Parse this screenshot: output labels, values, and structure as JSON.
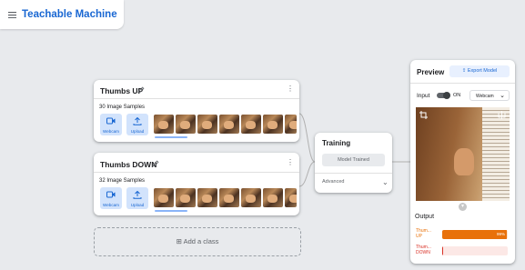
{
  "app": {
    "title": "Teachable Machine"
  },
  "classes": [
    {
      "name": "Thumbs UP",
      "samples": "30 Image Samples",
      "webcam_label": "Webcam",
      "upload_label": "Upload"
    },
    {
      "name": "Thumbs DOWN",
      "samples": "32 Image Samples",
      "webcam_label": "Webcam",
      "upload_label": "Upload"
    }
  ],
  "add_class_label": "Add a class",
  "training": {
    "title": "Training",
    "status_button": "Model Trained",
    "advanced_label": "Advanced"
  },
  "preview": {
    "title": "Preview",
    "export_label": "Export Model",
    "input_label": "Input",
    "toggle_state": "ON",
    "source_select": "Webcam",
    "output_label": "Output",
    "outputs": [
      {
        "label_line1": "Thum...",
        "label_line2": "UP",
        "percent": 99,
        "percent_text": "99%",
        "color": "#e8710a",
        "track": "#fbe4d0"
      },
      {
        "label_line1": "Thum...",
        "label_line2": "DOWN",
        "percent": 1,
        "percent_text": "",
        "color": "#d93025",
        "track": "#fce8e6"
      }
    ]
  },
  "colors": {
    "accent": "#1967d2",
    "background": "#e8eaed"
  }
}
